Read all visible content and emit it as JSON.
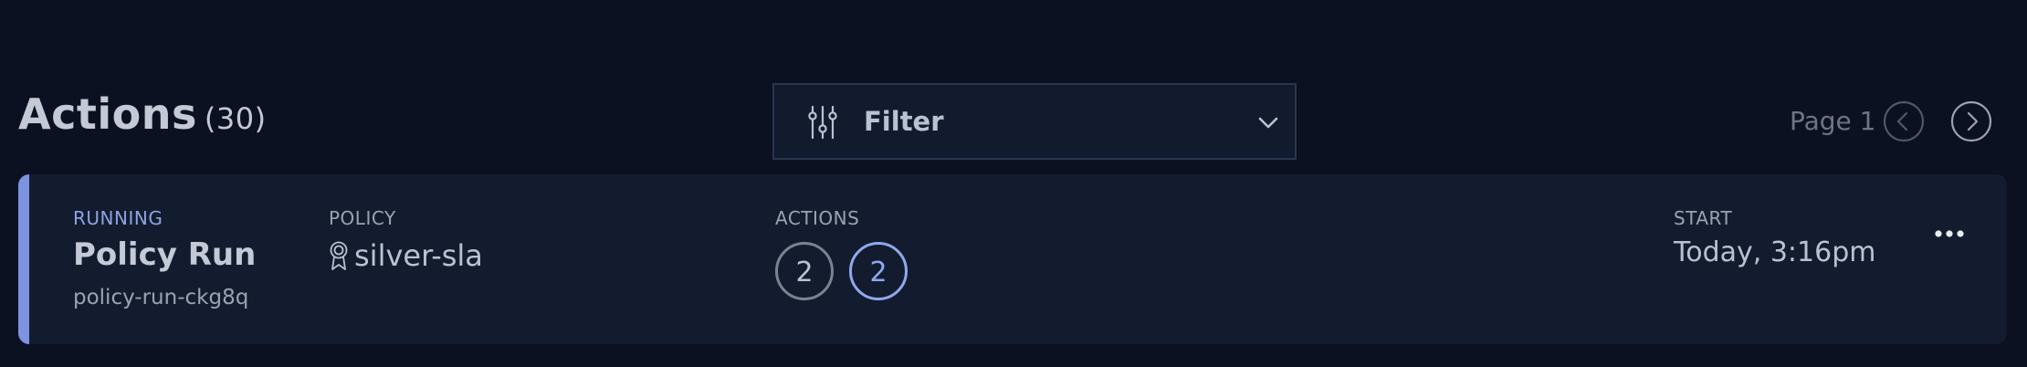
{
  "header": {
    "title": "Actions",
    "count": "(30)",
    "filter": {
      "label": "Filter",
      "icon": "sliders-icon"
    },
    "pagination": {
      "label": "Page 1",
      "prev_icon": "chevron-left-icon",
      "next_icon": "chevron-right-icon"
    }
  },
  "run": {
    "status": "RUNNING",
    "title": "Policy Run",
    "id": "policy-run-ckg8q",
    "policy_label": "POLICY",
    "policy_value": "silver-sla",
    "policy_icon": "award-badge-icon",
    "actions_label": "ACTIONS",
    "action_counts": [
      "2",
      "2"
    ],
    "start_label": "START",
    "start_value": "Today, 3:16pm",
    "menu_icon": "more-horizontal-icon"
  },
  "colors": {
    "background": "#0b1120",
    "card": "#131c2e",
    "accent": "#7b93e0",
    "text": "#b9c2d0",
    "muted": "#6c7586"
  }
}
